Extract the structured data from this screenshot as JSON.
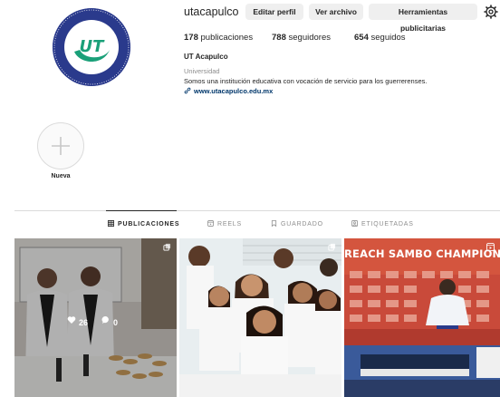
{
  "profile": {
    "username": "utacapulco",
    "avatar_alt": "UT",
    "buttons": {
      "edit": "Editar perfil",
      "archive": "Ver archivo",
      "tools": "Herramientas publicitarias"
    },
    "stats": {
      "posts_count": "178",
      "posts_label": "publicaciones",
      "followers_count": "788",
      "followers_label": "seguidores",
      "following_count": "654",
      "following_label": "seguidos"
    },
    "bio": {
      "name": "UT Acapulco",
      "category": "Universidad",
      "text": "Somos una institución educativa con vocación de servicio para los guerrerenses.",
      "link": "www.utacapulco.edu.mx"
    }
  },
  "highlights": [
    {
      "label": "Nueva"
    }
  ],
  "tabs": [
    {
      "label": "PUBLICACIONES",
      "icon": "grid-icon",
      "active": true
    },
    {
      "label": "REELS",
      "icon": "reels-icon",
      "active": false
    },
    {
      "label": "GUARDADO",
      "icon": "bookmark-icon",
      "active": false
    },
    {
      "label": "ETIQUETADAS",
      "icon": "tag-icon",
      "active": false
    }
  ],
  "posts": [
    {
      "likes": "26",
      "comments": "0",
      "multi": true
    },
    {
      "multi": true
    },
    {
      "banner": "REACH SAMBO CHAMPIONSHIP",
      "video": true
    }
  ],
  "colors": {
    "accent_link": "#00376b",
    "button_bg": "#efefef",
    "muted": "#8e8e8e",
    "logo_blue": "#2a3a8c",
    "logo_green": "#1aa079"
  }
}
